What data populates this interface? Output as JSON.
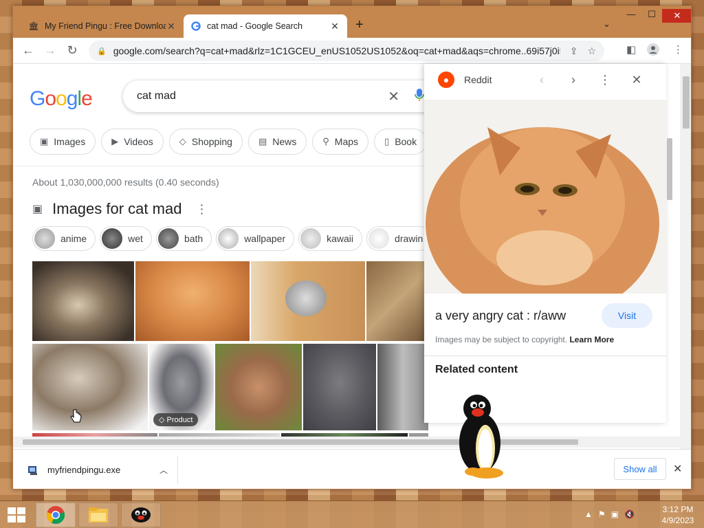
{
  "browser": {
    "tabs": [
      {
        "title": "My Friend Pingu : Free Downloa",
        "favicon": "archive-icon"
      },
      {
        "title": "cat mad - Google Search",
        "favicon": "google-icon"
      }
    ],
    "new_tab_label": "+",
    "url": "google.com/search?q=cat+mad&rlz=1C1GCEU_enUS1052US1052&oq=cat+mad&aqs=chrome..69i57j0i5..."
  },
  "google": {
    "logo_letters": [
      "G",
      "o",
      "o",
      "g",
      "l",
      "e"
    ],
    "query": "cat mad",
    "chips": [
      "Images",
      "Videos",
      "Shopping",
      "News",
      "Maps",
      "Book"
    ],
    "stats": "About 1,030,000,000 results (0.40 seconds)",
    "images_title": "Images for cat mad",
    "refine": [
      "anime",
      "wet",
      "bath",
      "wallpaper",
      "kawaii",
      "drawin"
    ],
    "product_badge": "Product"
  },
  "panel": {
    "source": "Reddit",
    "title": "a very angry cat : r/aww",
    "visit_label": "Visit",
    "copyright_text": "Images may be subject to copyright.",
    "learn_more": "Learn More",
    "related": "Related content"
  },
  "downloads": {
    "file": "myfriendpingu.exe",
    "show_all": "Show all"
  },
  "taskbar": {
    "time": "3:12 PM",
    "date": "4/9/2023"
  },
  "colors": {
    "google_blue": "#4285F4",
    "google_red": "#EA4335",
    "google_yellow": "#FBBC05",
    "google_green": "#34A853",
    "reddit": "#FF4500",
    "link_blue": "#1A73E8"
  }
}
